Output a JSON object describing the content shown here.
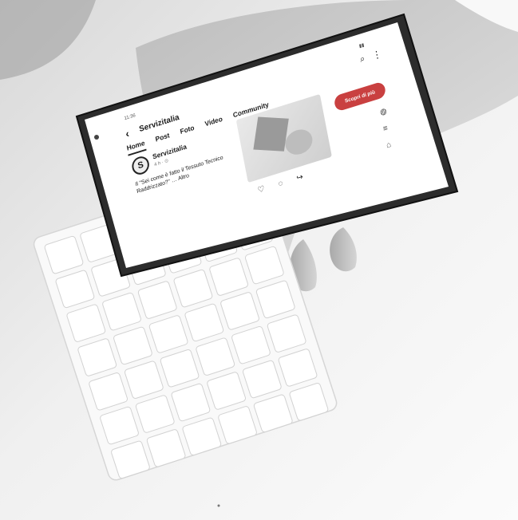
{
  "scene": {
    "description_items": [
      "phone",
      "hand",
      "keyboard"
    ],
    "colors": {
      "background": "#f5f5f5",
      "phone_body": "#2a2a2a",
      "screen": "#ffffff",
      "accent": "#c94040"
    }
  },
  "phone": {
    "status": {
      "time": "11:36",
      "battery": "▮▮"
    },
    "header": {
      "title": "Servizitalia"
    },
    "tabs": [
      {
        "label": "Home"
      },
      {
        "label": "Post"
      },
      {
        "label": "Foto"
      },
      {
        "label": "Video"
      },
      {
        "label": "Community"
      }
    ],
    "post": {
      "author": "Servizitalia",
      "meta": "4 h · ⊙",
      "text": "Il \"Sei come è fatto il Tessuto Tecnico Raddrizzato?\"  … Altro"
    },
    "subscribe_label": "Scopri di più"
  }
}
